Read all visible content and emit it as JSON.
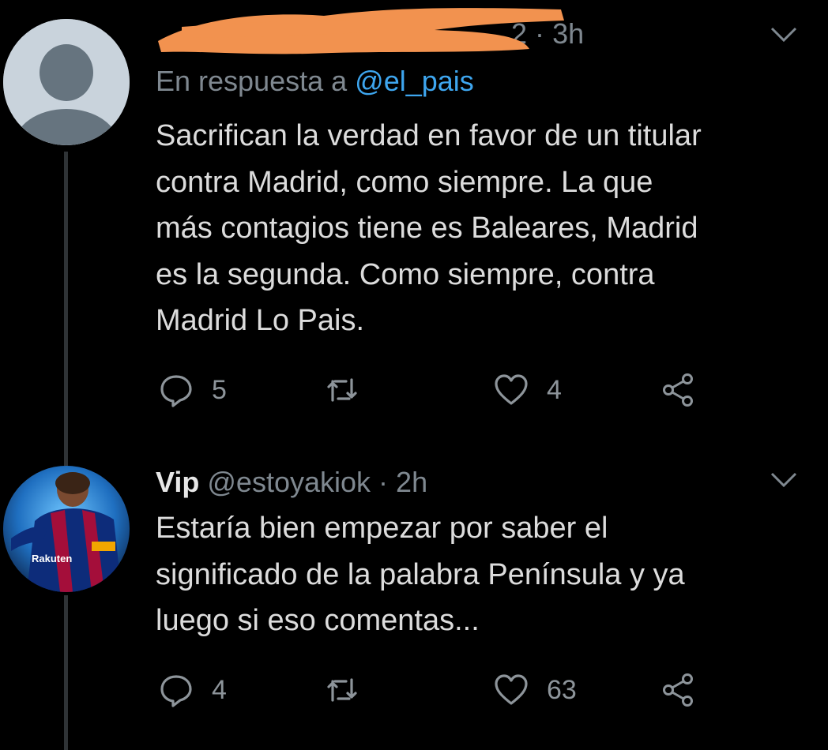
{
  "tweet1": {
    "name_redacted": true,
    "handle_tail": "2",
    "separator": "·",
    "time": "3h",
    "reply_prefix": "En respuesta a",
    "reply_mention": "@el_pais",
    "text": "Sacrifican la verdad en favor de un titular\ncontra Madrid, como siempre. La que\nmás contagios tiene es Baleares, Madrid\nes la segunda. Como siempre, contra\nMadrid Lo Pais.",
    "replies": "5",
    "retweets": "",
    "likes": "4"
  },
  "tweet2": {
    "display_name": "Vip",
    "handle": "@estoyakiok",
    "separator": "·",
    "time": "2h",
    "text": "Estaría bien empezar por saber el\nsignificado de la palabra Península y ya\nluego si eso comentas...",
    "replies": "4",
    "retweets": "",
    "likes": "63",
    "avatar_shirt_text": "Rakuten"
  },
  "colors": {
    "background": "#000000",
    "secondary_text": "#7f8890",
    "link": "#3ea6ef",
    "redaction": "#f2924f",
    "icon": "#8d949a"
  }
}
